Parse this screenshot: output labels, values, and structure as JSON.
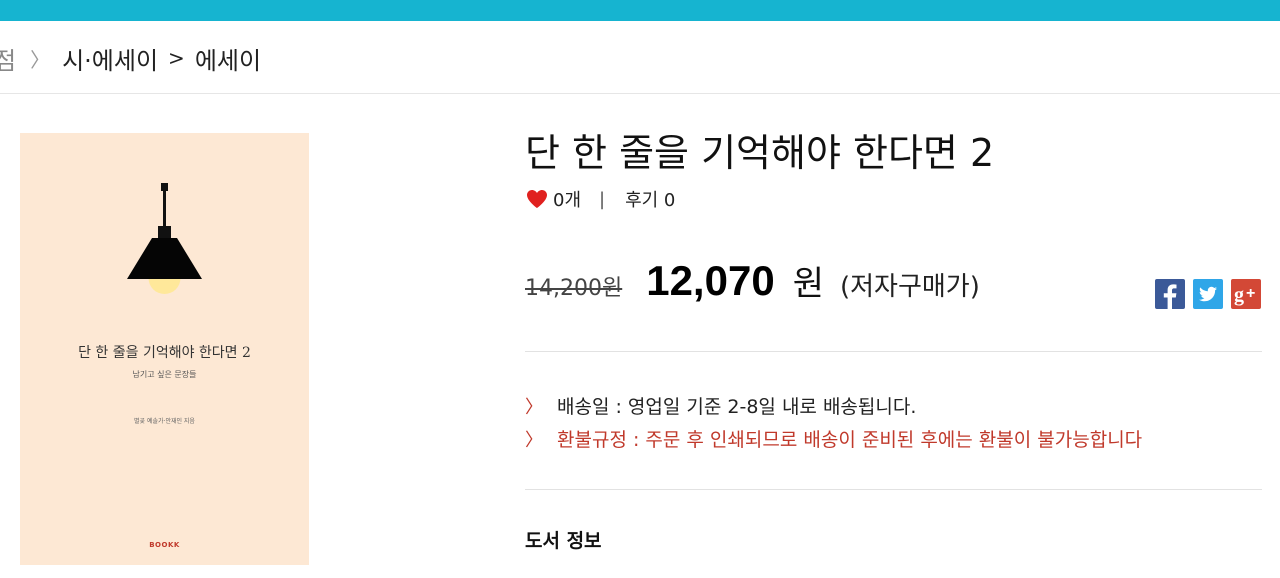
{
  "breadcrumb": {
    "first": "점",
    "category": "시·에세이",
    "separator": ">",
    "subcategory": "에세이"
  },
  "cover": {
    "title": "단 한 줄을 기억해야 한다면 2",
    "subtitle": "남기고 싶은 문장들",
    "author": "별곶 예솔가·안재인 지음",
    "publisher": "BOOKK"
  },
  "product": {
    "title": "단 한 줄을 기억해야 한다면 2",
    "likes": "0개",
    "meta_sep": "|",
    "reviews": "후기 0",
    "original_price": "14,200원",
    "sale_price": "12,070",
    "currency": "원",
    "price_note": "(저자구매가)"
  },
  "share": {
    "facebook_icon": "facebook-icon",
    "twitter_icon": "twitter-icon",
    "googleplus_icon": "google-plus-icon"
  },
  "info": {
    "shipping": "배송일 : 영업일 기준 2-8일 내로 배송됩니다.",
    "refund": "환불규정 : 주문 후 인쇄되므로 배송이 준비된 후에는 환불이 불가능합니다"
  },
  "section": {
    "book_info_title": "도서 정보"
  },
  "colors": {
    "topbar": "#16b4d0",
    "accent_red": "#c0392b",
    "cover_bg": "#fde8d4"
  }
}
